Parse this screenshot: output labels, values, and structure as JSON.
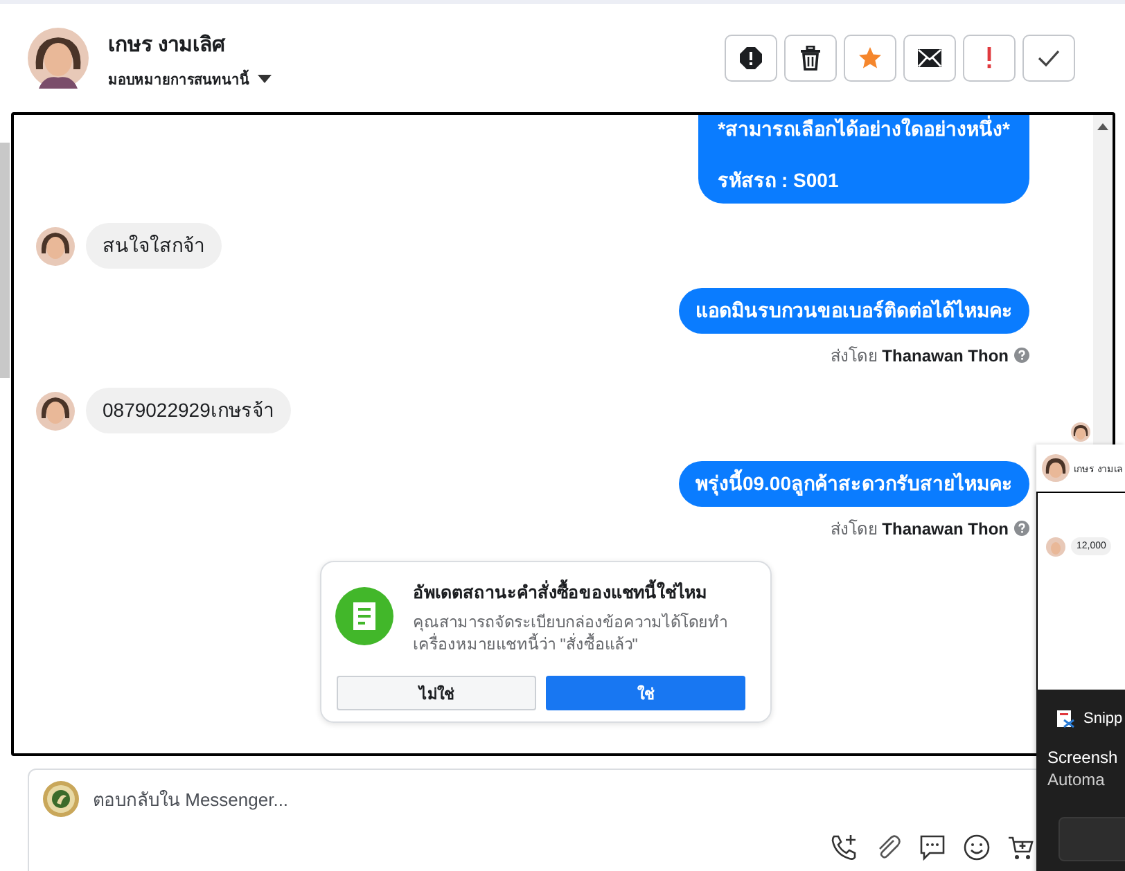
{
  "contact": {
    "name": "เกษร งามเลิศ",
    "assign": "มอบหมายการสนทนานี้"
  },
  "toolbar": [
    {
      "kind": "block"
    },
    {
      "kind": "trash"
    },
    {
      "kind": "star"
    },
    {
      "kind": "mail"
    },
    {
      "kind": "important"
    },
    {
      "kind": "done"
    }
  ],
  "messages": [
    {
      "kind": "out",
      "lines": [
        "*สามารถเลือกได้อย่างใดอย่างหนึ่ง*",
        "รหัสรถ : S001"
      ]
    },
    {
      "kind": "in",
      "lines": [
        "สนใจใสกจ้า"
      ]
    },
    {
      "kind": "out",
      "lines": [
        "แอดมินรบกวนขอเบอร์ติดต่อได้ไหมคะ"
      ],
      "sender_label": "ส่งโดย",
      "sender": "Thanawan Thon"
    },
    {
      "kind": "in",
      "lines": [
        "0879022929เกษรจ้า"
      ],
      "read": true
    },
    {
      "kind": "out",
      "lines": [
        "พรุ่งนี้09.00ลูกค้าสะดวกรับสายไหมคะ"
      ],
      "sender_label": "ส่งโดย",
      "sender": "Thanawan Thon"
    }
  ],
  "prompt": {
    "title": "อัพเดตสถานะคำสั่งซื้อของแชทนี้ใช่ไหม",
    "body": "คุณสามารถจัดระเบียบกล่องข้อความได้โดยทำเครื่องหมายแชทนี้ว่า \"สั่งซื้อแล้ว\"",
    "buttons": [
      {
        "label": "ไม่ใช่",
        "primary": false
      },
      {
        "label": "ใช่",
        "primary": true
      }
    ]
  },
  "composer": {
    "placeholder": "ตอบกลับใน Messenger...",
    "tools": [
      {
        "kind": "call"
      },
      {
        "kind": "attach"
      },
      {
        "kind": "chat"
      },
      {
        "kind": "emoji"
      },
      {
        "kind": "cart"
      }
    ]
  },
  "overlay": {
    "preview": {
      "name": "เกษร งามเล",
      "message": "12,000"
    },
    "notification": {
      "app": "Snipp",
      "title": "Screensh",
      "body": "Automa"
    }
  }
}
